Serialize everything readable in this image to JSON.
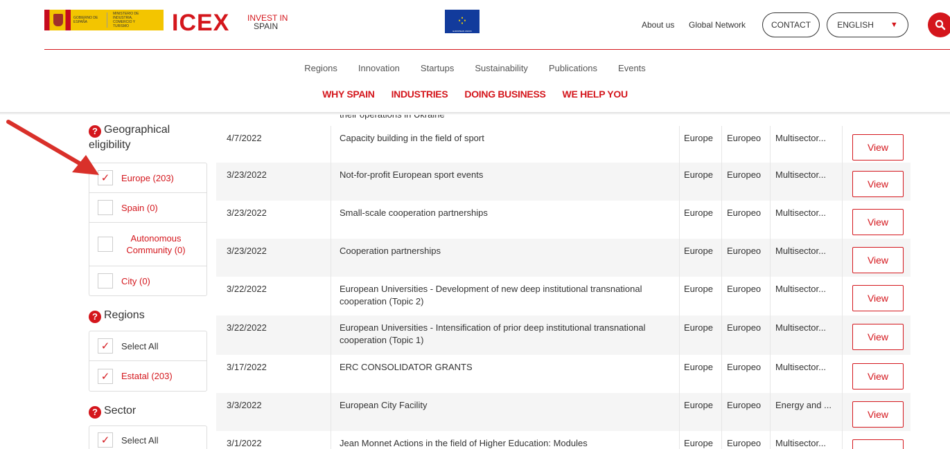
{
  "header": {
    "gov_logo_text": [
      "GOBIERNO DE ESPAÑA",
      "MINISTERIO DE INDUSTRIA, COMERCIO Y TURISMO"
    ],
    "icex_logo": "ICEX",
    "invest_logo": [
      "INVEST IN",
      "SPAIN"
    ],
    "eu_label": "EUROPEAN UNION",
    "about": "About us",
    "network": "Global Network",
    "contact": "CONTACT",
    "language": "ENGLISH"
  },
  "nav": {
    "secondary": [
      "Regions",
      "Innovation",
      "Startups",
      "Sustainability",
      "Publications",
      "Events"
    ],
    "primary": [
      "WHY SPAIN",
      "INDUSTRIES",
      "DOING BUSINESS",
      "WE HELP YOU"
    ]
  },
  "sidebar": {
    "geo": {
      "heading": "Geographical eligibility",
      "items": [
        {
          "label": "Europe (203)",
          "checked": true
        },
        {
          "label": "Spain (0)",
          "checked": false
        },
        {
          "label": "Autonomous Community (0)",
          "checked": false
        },
        {
          "label": "City (0)",
          "checked": false
        }
      ]
    },
    "regions": {
      "heading": "Regions",
      "items": [
        {
          "label": "Select All",
          "checked": true
        },
        {
          "label": "Estatal (203)",
          "checked": true
        }
      ]
    },
    "sector": {
      "heading": "Sector",
      "items": [
        {
          "label": "Select All",
          "checked": true
        }
      ]
    }
  },
  "table": {
    "partial_text": "their operations in Ukraine",
    "view_label": "View",
    "rows": [
      {
        "date": "4/7/2022",
        "title": "Capacity building in the field of sport",
        "region": "Europe",
        "scope": "Europeo",
        "sector": "Multisector..."
      },
      {
        "date": "3/23/2022",
        "title": "Not-for-profit European sport events",
        "region": "Europe",
        "scope": "Europeo",
        "sector": "Multisector..."
      },
      {
        "date": "3/23/2022",
        "title": "Small-scale cooperation partnerships",
        "region": "Europe",
        "scope": "Europeo",
        "sector": "Multisector..."
      },
      {
        "date": "3/23/2022",
        "title": "Cooperation partnerships",
        "region": "Europe",
        "scope": "Europeo",
        "sector": "Multisector..."
      },
      {
        "date": "3/22/2022",
        "title": "European Universities - Development of new deep institutional transnational cooperation (Topic 2)",
        "region": "Europe",
        "scope": "Europeo",
        "sector": "Multisector..."
      },
      {
        "date": "3/22/2022",
        "title": "European Universities - Intensification of prior deep institutional transnational cooperation (Topic 1)",
        "region": "Europe",
        "scope": "Europeo",
        "sector": "Multisector..."
      },
      {
        "date": "3/17/2022",
        "title": "ERC CONSOLIDATOR GRANTS",
        "region": "Europe",
        "scope": "Europeo",
        "sector": "Multisector..."
      },
      {
        "date": "3/3/2022",
        "title": "European City Facility",
        "region": "Europe",
        "scope": "Europeo",
        "sector": "Energy and ..."
      },
      {
        "date": "3/1/2022",
        "title": "Jean Monnet Actions in the field of Higher Education: Modules",
        "region": "Europe",
        "scope": "Europeo",
        "sector": "Multisector..."
      }
    ]
  },
  "colors": {
    "accent": "#d4161c",
    "annotation_arrow": "#d9302a"
  }
}
